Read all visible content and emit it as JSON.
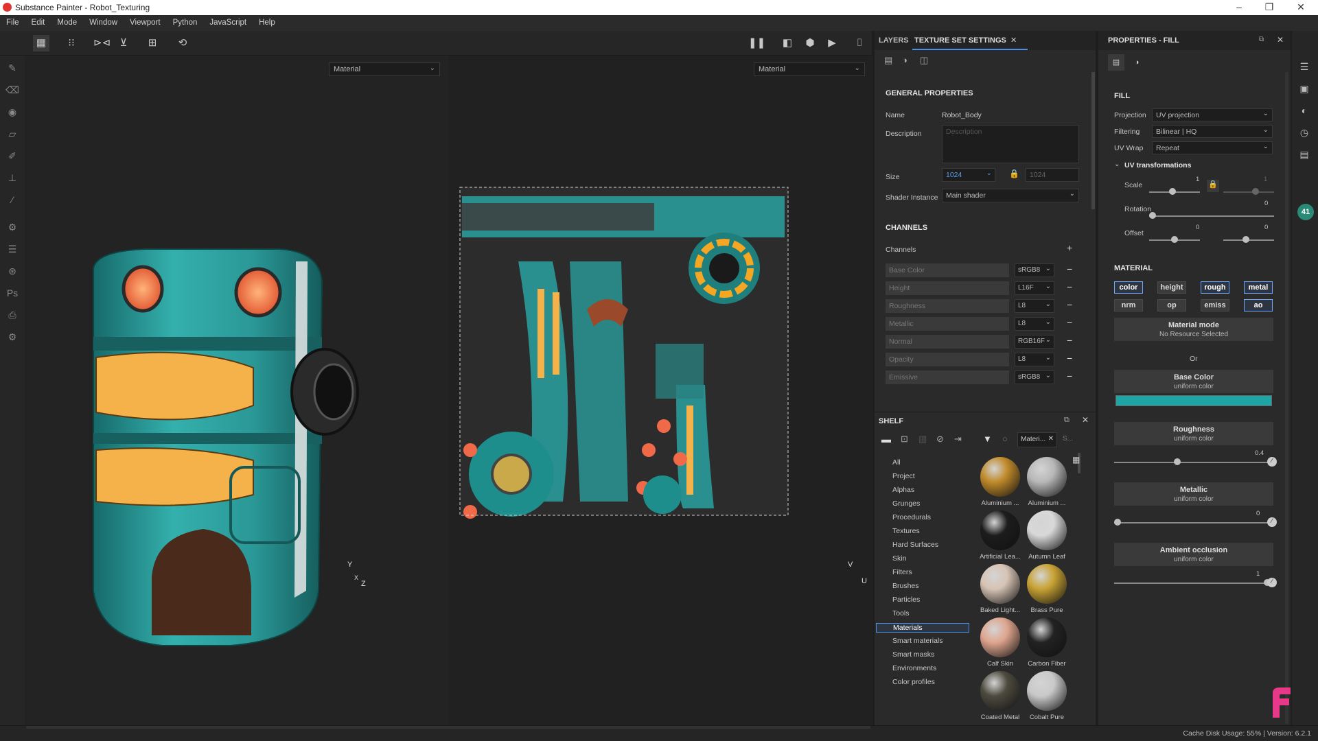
{
  "window": {
    "title": "Substance Painter - Robot_Texturing",
    "minimize": "–",
    "maximize": "❐",
    "close": "✕"
  },
  "menu": [
    "File",
    "Edit",
    "Mode",
    "Window",
    "Viewport",
    "Python",
    "JavaScript",
    "Help"
  ],
  "viewport3d": {
    "channel_select": "Material",
    "axis_y": "Y",
    "axis_x": "X",
    "axis_z": "Z"
  },
  "viewport2d": {
    "channel_select": "Material",
    "axis_v": "V",
    "axis_u": "U"
  },
  "layers_panel": {
    "tab_layers": "LAYERS",
    "tab_texture_set": "TEXTURE SET SETTINGS",
    "general_title": "GENERAL PROPERTIES",
    "name_label": "Name",
    "name_value": "Robot_Body",
    "description_label": "Description",
    "description_placeholder": "Description",
    "size_label": "Size",
    "size_value": "1024",
    "size_value2": "1024",
    "shader_label": "Shader Instance",
    "shader_value": "Main shader",
    "channels_title": "CHANNELS",
    "channels_label": "Channels",
    "channels": [
      {
        "name": "Base Color",
        "format": "sRGB8"
      },
      {
        "name": "Height",
        "format": "L16F"
      },
      {
        "name": "Roughness",
        "format": "L8"
      },
      {
        "name": "Metallic",
        "format": "L8"
      },
      {
        "name": "Normal",
        "format": "RGB16F"
      },
      {
        "name": "Opacity",
        "format": "L8"
      },
      {
        "name": "Emissive",
        "format": "sRGB8"
      }
    ]
  },
  "shelf": {
    "title": "SHELF",
    "filter_tag": "Materi...",
    "search_placeholder": "S...",
    "categories": [
      "All",
      "Project",
      "Alphas",
      "Grunges",
      "Procedurals",
      "Textures",
      "Hard Surfaces",
      "Skin",
      "Filters",
      "Brushes",
      "Particles",
      "Tools",
      "Materials",
      "Smart materials",
      "Smart masks",
      "Environments",
      "Color profiles"
    ],
    "selected_category": "Materials",
    "materials": [
      {
        "label": "Aluminium ...",
        "color": "#c08a2a"
      },
      {
        "label": "Aluminium ...",
        "color": "#b8b8b8"
      },
      {
        "label": "Artificial Lea...",
        "color": "#1c1c1c"
      },
      {
        "label": "Autumn Leaf",
        "color": "#d8d8d8"
      },
      {
        "label": "Baked Light...",
        "color": "#d6c3b4"
      },
      {
        "label": "Brass Pure",
        "color": "#c8a233"
      },
      {
        "label": "Calf Skin",
        "color": "#dfa58e"
      },
      {
        "label": "Carbon Fiber",
        "color": "#222222"
      },
      {
        "label": "Coated Metal",
        "color": "#4d4a3e"
      },
      {
        "label": "Cobalt Pure",
        "color": "#c9c9c9"
      }
    ]
  },
  "properties": {
    "title": "PROPERTIES - FILL",
    "fill_title": "FILL",
    "projection_label": "Projection",
    "projection_value": "UV projection",
    "filtering_label": "Filtering",
    "filtering_value": "Bilinear | HQ",
    "uvwrap_label": "UV Wrap",
    "uvwrap_value": "Repeat",
    "uvtrans_title": "UV transformations",
    "scale_label": "Scale",
    "scale_value": "1",
    "scale_value2": "1",
    "rotation_label": "Rotation",
    "rotation_value": "0",
    "offset_label": "Offset",
    "offset_value": "0",
    "offset_value2": "0",
    "material_title": "MATERIAL",
    "chips_row1": [
      "color",
      "height",
      "rough",
      "metal"
    ],
    "chips_row2": [
      "nrm",
      "op",
      "emiss",
      "ao"
    ],
    "material_mode_title": "Material mode",
    "material_mode_sub": "No Resource Selected",
    "or_label": "Or",
    "base_color_title": "Base Color",
    "base_color_sub": "uniform color",
    "base_color_value": "#1fa5a6",
    "roughness_title": "Roughness",
    "roughness_sub": "uniform color",
    "roughness_value": "0.4",
    "metallic_title": "Metallic",
    "metallic_sub": "uniform color",
    "metallic_value": "0",
    "ao_title": "Ambient occlusion",
    "ao_sub": "uniform color",
    "ao_value": "1"
  },
  "rightbar": {
    "badge": "41"
  },
  "status": {
    "text": "Cache Disk Usage:   55% | Version: 6.2.1"
  }
}
